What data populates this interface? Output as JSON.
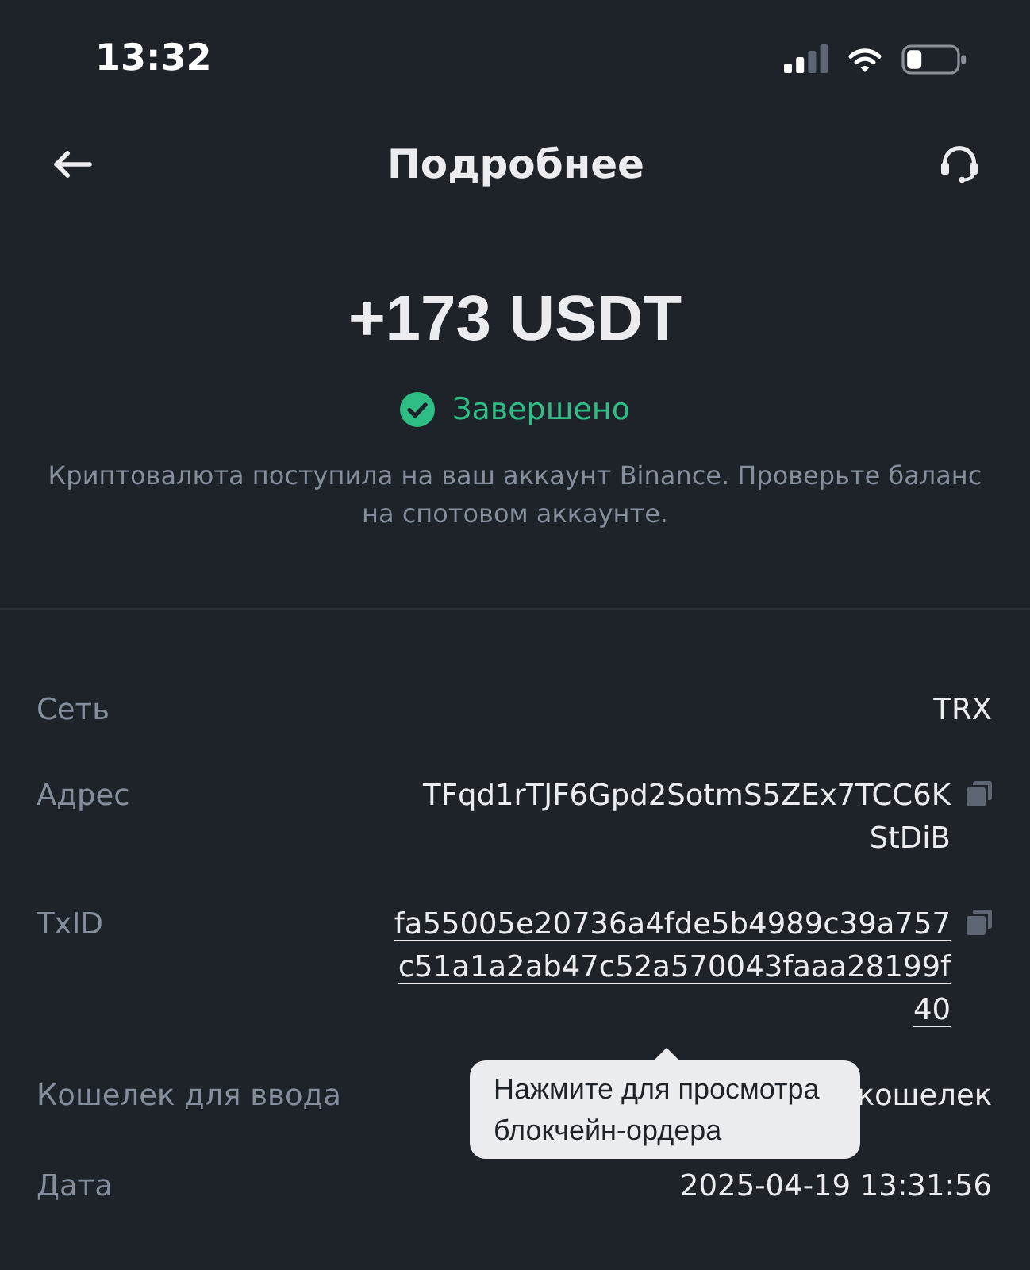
{
  "status_bar": {
    "time": "13:32"
  },
  "header": {
    "title": "Подробнее"
  },
  "amount": "+173 USDT",
  "status": {
    "label": "Завершено",
    "kind": "completed"
  },
  "message": "Криптовалюта поступила на ваш аккаунт Binance. Проверьте баланс на спотовом аккаунте.",
  "details": [
    {
      "label": "Сеть",
      "value": "TRX",
      "kind": "text"
    },
    {
      "label": "Адрес",
      "value": "TFqd1rTJF6Gpd2SotmS5ZEx7TCC6KStDiB",
      "kind": "address"
    },
    {
      "label": "TxID",
      "value": "fa55005e20736a4fde5b4989c39a757c51a1a2ab47c52a570043faaa28199f40",
      "kind": "hash"
    },
    {
      "label": "Кошелек для ввода",
      "value": "кошелек",
      "kind": "text"
    },
    {
      "label": "Дата",
      "value": "2025-04-19 13:31:56",
      "kind": "text"
    }
  ],
  "tooltip": {
    "text": "Нажмите для просмотра блокчейн-ордера"
  }
}
